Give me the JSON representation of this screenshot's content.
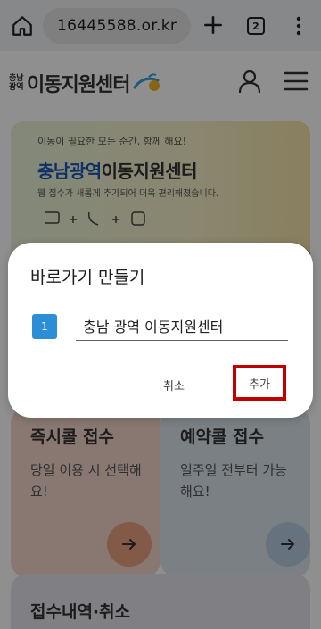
{
  "browser": {
    "url": "16445588.or.kr",
    "tab_count": "2"
  },
  "site": {
    "logo_mini": "충남\n광역",
    "logo_name": "이동지원센터"
  },
  "hero": {
    "tagline": "이동이 필요한 모든 순간, 함께 해요!",
    "title_a": "충남광역",
    "title_b": "이동지원센터",
    "subtitle": "웹 접수가 새롭게 추가되어 더욱 편리해졌습니다."
  },
  "cards": {
    "instant_title": "즉시콜 접수",
    "instant_desc": "당일 이용 시 선택해요!",
    "reserve_title": "예약콜 접수",
    "reserve_desc": "일주일 전부터 가능해요!",
    "history_title": "접수내역·취소"
  },
  "dialog": {
    "title": "바로가기 만들기",
    "favicon_label": "1",
    "name_value": "충남 광역 이동지원센터",
    "cancel_label": "취소",
    "add_label": "추가"
  },
  "colors": {
    "accent_blue": "#1a56b8",
    "highlight_red": "#c00000",
    "favicon_blue": "#2b8ed6"
  }
}
